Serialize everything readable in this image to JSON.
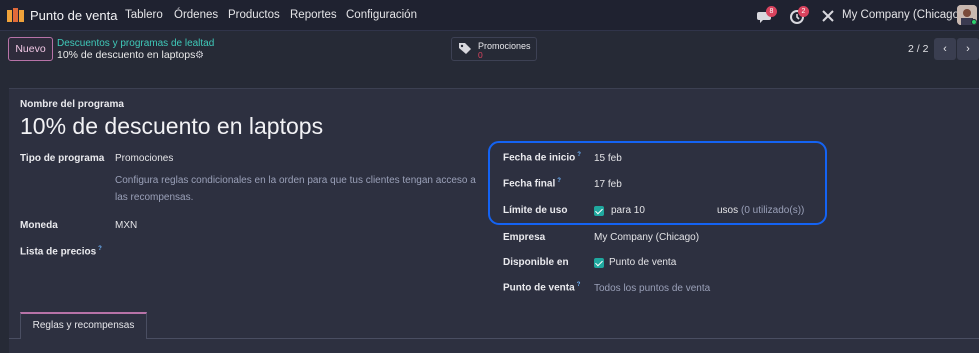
{
  "app": {
    "name": "Punto de venta"
  },
  "nav": [
    "Tablero",
    "Órdenes",
    "Productos",
    "Reportes",
    "Configuración"
  ],
  "systray": {
    "messages_count": "8",
    "activities_count": "2",
    "company": "My Company (Chicago)"
  },
  "control": {
    "new_label": "Nuevo",
    "breadcrumb": "Descuentos y programas de lealtad",
    "record_title": "10% de descuento en laptops",
    "smart_button": {
      "label": "Promociones",
      "count": "0"
    },
    "pager": "2 / 2"
  },
  "form": {
    "program_name_label": "Nombre del programa",
    "program_name": "10% de descuento en laptops",
    "program_type_label": "Tipo de programa",
    "program_type": "Promociones",
    "program_type_help": "Configura reglas condicionales en la orden para que tus clientes tengan acceso a las recompensas.",
    "currency_label": "Moneda",
    "currency": "MXN",
    "pricelist_label": "Lista de precios",
    "start_date_label": "Fecha de inicio",
    "start_date": "15 feb",
    "end_date_label": "Fecha final",
    "end_date": "17 feb",
    "usage_limit_label": "Límite de uso",
    "usage_limit_prefix": "para 10",
    "usage_limit_suffix": "usos",
    "usage_used": "(0 utilizado(s))",
    "company_label": "Empresa",
    "company": "My Company (Chicago)",
    "available_label": "Disponible en",
    "available": "Punto de venta",
    "pos_label": "Punto de venta",
    "pos_placeholder": "Todos los puntos de venta"
  },
  "tabs": [
    "Reglas y recompensas"
  ],
  "colors": {
    "accent": "#b873a8",
    "teal": "#3fc9b9",
    "highlight": "#1463f3",
    "badge": "#d9435e"
  }
}
